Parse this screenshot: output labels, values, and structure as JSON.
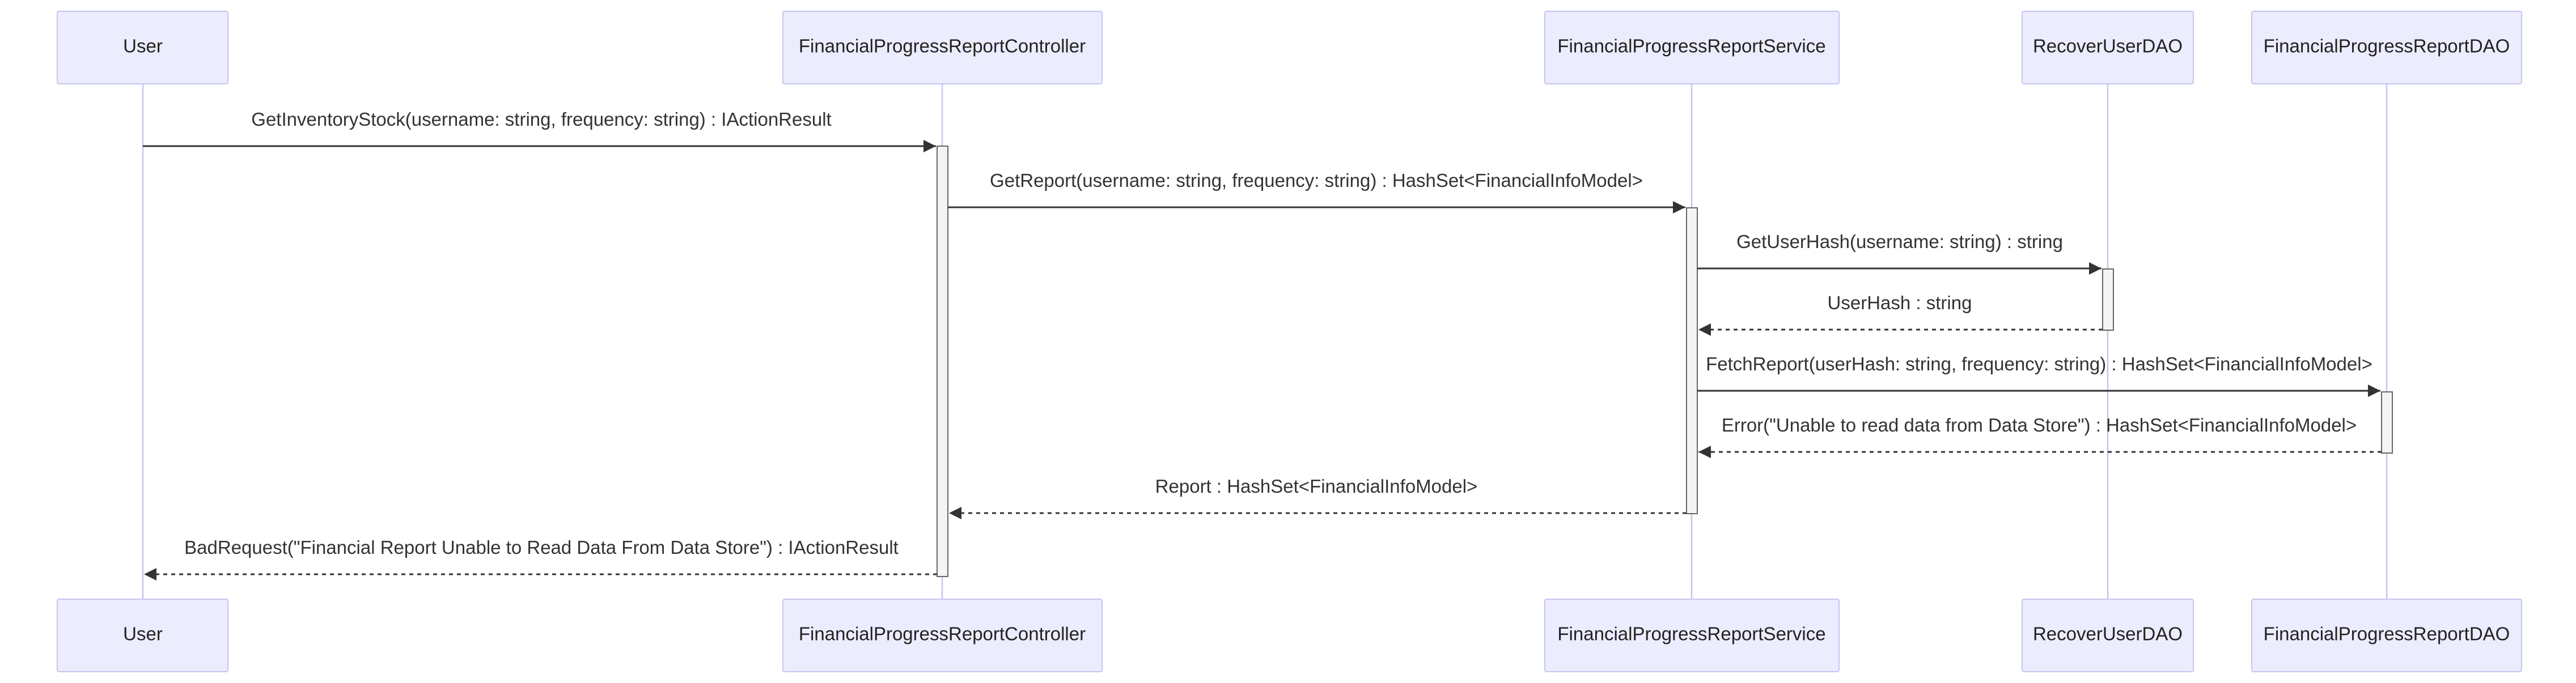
{
  "participants": [
    {
      "id": "user",
      "label": "User"
    },
    {
      "id": "controller",
      "label": "FinancialProgressReportController"
    },
    {
      "id": "service",
      "label": "FinancialProgressReportService"
    },
    {
      "id": "recoverdao",
      "label": "RecoverUserDAO"
    },
    {
      "id": "reportdao",
      "label": "FinancialProgressReportDAO"
    }
  ],
  "messages": [
    {
      "from": "user",
      "to": "controller",
      "label": "GetInventoryStock(username: string, frequency: string) : IActionResult",
      "style": "solid"
    },
    {
      "from": "controller",
      "to": "service",
      "label": "GetReport(username: string, frequency: string) : HashSet<FinancialInfoModel>",
      "style": "solid"
    },
    {
      "from": "service",
      "to": "recoverdao",
      "label": "GetUserHash(username: string) : string",
      "style": "solid"
    },
    {
      "from": "recoverdao",
      "to": "service",
      "label": "UserHash : string",
      "style": "dashed"
    },
    {
      "from": "service",
      "to": "reportdao",
      "label": "FetchReport(userHash: string, frequency: string) : HashSet<FinancialInfoModel>",
      "style": "solid"
    },
    {
      "from": "reportdao",
      "to": "service",
      "label": "Error(\"Unable to read data from Data Store\") : HashSet<FinancialInfoModel>",
      "style": "dashed"
    },
    {
      "from": "service",
      "to": "controller",
      "label": "Report : HashSet<FinancialInfoModel>",
      "style": "dashed"
    },
    {
      "from": "controller",
      "to": "user",
      "label": "BadRequest(\"Financial Report Unable to Read Data From Data Store\") : IActionResult",
      "style": "dashed"
    }
  ],
  "colors": {
    "actor_fill": "#ececff",
    "actor_border": "#c5c5f0",
    "lifeline": "#c8c3ef",
    "arrow": "#333333",
    "text": "#333333"
  }
}
